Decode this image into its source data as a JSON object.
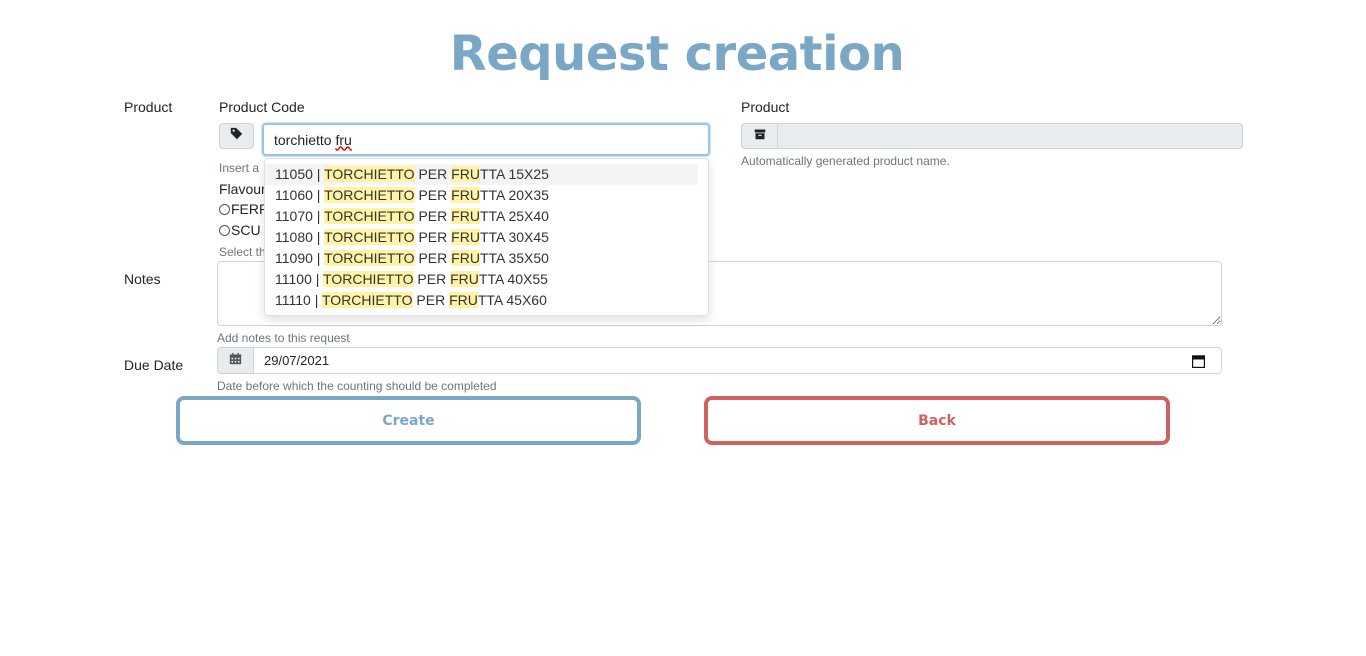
{
  "title": "Request creation",
  "form": {
    "product_section_label": "Product",
    "product_code": {
      "label": "Product Code",
      "value_prefix": "torchietto ",
      "value_typed": "fru",
      "icon": "tag-icon",
      "help_prefix": "Insert a"
    },
    "product_name": {
      "label": "Product",
      "value": "",
      "icon": "archive-icon",
      "help": "Automatically generated product name."
    },
    "flavour": {
      "label": "Flavour",
      "options": [
        "FERR",
        "SCU"
      ],
      "help": "Select th"
    },
    "notes": {
      "label": "Notes",
      "value": "",
      "help": "Add notes to this request"
    },
    "due_date": {
      "label": "Due Date",
      "value": "29/07/2021",
      "icon": "calendar-icon",
      "help": "Date before which the counting should be completed"
    }
  },
  "suggestions": [
    {
      "code": "11050",
      "sep": " | ",
      "h1": "TORCHIETTO",
      "mid": " PER ",
      "h2": "FRU",
      "rest": "TTA 15X25"
    },
    {
      "code": "11060",
      "sep": " | ",
      "h1": "TORCHIETTO",
      "mid": " PER ",
      "h2": "FRU",
      "rest": "TTA 20X35"
    },
    {
      "code": "11070",
      "sep": " | ",
      "h1": "TORCHIETTO",
      "mid": " PER ",
      "h2": "FRU",
      "rest": "TTA 25X40"
    },
    {
      "code": "11080",
      "sep": " | ",
      "h1": "TORCHIETTO",
      "mid": " PER ",
      "h2": "FRU",
      "rest": "TTA 30X45"
    },
    {
      "code": "11090",
      "sep": " | ",
      "h1": "TORCHIETTO",
      "mid": " PER ",
      "h2": "FRU",
      "rest": "TTA 35X50"
    },
    {
      "code": "11100",
      "sep": " | ",
      "h1": "TORCHIETTO",
      "mid": " PER ",
      "h2": "FRU",
      "rest": "TTA 40X55"
    },
    {
      "code": "11110",
      "sep": " | ",
      "h1": "TORCHIETTO",
      "mid": " PER ",
      "h2": "FRU",
      "rest": "TTA 45X60"
    }
  ],
  "buttons": {
    "create": "Create",
    "back": "Back"
  },
  "colors": {
    "primary": "#7ba7c7",
    "danger": "#d06161",
    "highlight": "#fff3a6"
  }
}
